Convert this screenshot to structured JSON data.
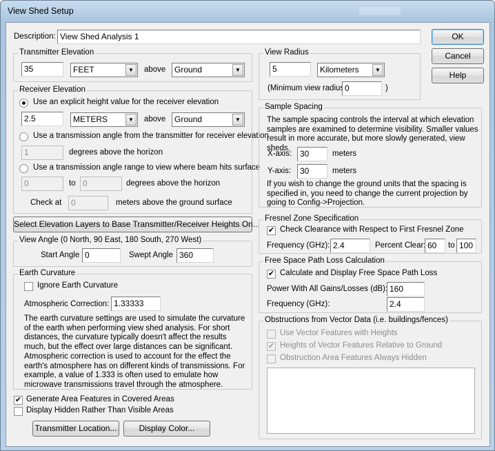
{
  "window": {
    "title": "View Shed Setup"
  },
  "description": {
    "label": "Description:",
    "value": "View Shed Analysis 1"
  },
  "buttons": {
    "ok": "OK",
    "cancel": "Cancel",
    "help": "Help"
  },
  "transmitter": {
    "legend": "Transmitter Elevation",
    "height": "35",
    "units": "FEET",
    "above_label": "above",
    "reference": "Ground"
  },
  "receiver": {
    "legend": "Receiver Elevation",
    "opt1_label": "Use an explicit height value for the receiver elevation",
    "height": "2.5",
    "units": "METERS",
    "above_label": "above",
    "reference": "Ground",
    "opt2_label": "Use a transmission angle from the transmitter for receiver elevation",
    "angle": "1",
    "angle_label": "degrees above the horizon",
    "opt3_label": "Use a transmission angle range to view where beam hits surface",
    "range_from": "0",
    "to_label": "to",
    "range_to": "0",
    "range_label": "degrees above the horizon",
    "check_at_label": "Check at",
    "check_at": "0",
    "check_at_suffix": "meters above the ground surface"
  },
  "elevation_layers_button": "Select Elevation Layers to Base Transmitter/Receiver Heights On...",
  "view_angle": {
    "legend": "View Angle (0 North, 90 East, 180 South, 270 West)",
    "start_label": "Start Angle",
    "start": "0",
    "swept_label": "Swept Angle",
    "swept": "360"
  },
  "curvature": {
    "legend": "Earth Curvature",
    "ignore_label": "Ignore Earth Curvature",
    "atmos_label": "Atmospheric Correction:",
    "atmos": "1.33333",
    "para1": "The earth curvature settings are used to simulate the curvature of the earth when performing view shed analysis. For short distances, the curvature typically doesn't affect the results much, but the effect over large distances can be significant.",
    "para2": "Atmospheric correction is used to account for the effect the earth's atmosphere has on different kinds of transmissions. For example, a value of 1.333 is often used to emulate how microwave transmissions travel through the atmosphere."
  },
  "options": {
    "generate_area": "Generate Area Features in Covered Areas",
    "display_hidden": "Display Hidden Rather Than Visible Areas"
  },
  "bottom_buttons": {
    "transmitter_location": "Transmitter Location...",
    "display_color": "Display Color..."
  },
  "view_radius": {
    "legend": "View Radius",
    "value": "5",
    "units": "Kilometers",
    "min_label": "(Minimum view radius:",
    "min": "0",
    "min_close": ")"
  },
  "sample_spacing": {
    "legend": "Sample Spacing",
    "para1": "The sample spacing controls the interval at which elevation samples are examined to determine visibility. Smaller values result in more accurate, but more slowly generated, view sheds.",
    "x_label": "X-axis:",
    "x": "30",
    "x_units": "meters",
    "y_label": "Y-axis:",
    "y": "30",
    "y_units": "meters",
    "para2": "If you wish to change the ground units that the spacing is specified in, you need to change the current projection by going to Config->Projection."
  },
  "fresnel": {
    "legend": "Fresnel Zone Specification",
    "check_label": "Check Clearance with Respect to First Fresnel Zone",
    "freq_label": "Frequency (GHz):",
    "freq": "2.4",
    "pct_label": "Percent Clear:",
    "pct_from": "60",
    "to_label": "to",
    "pct_to": "100"
  },
  "fspl": {
    "legend": "Free Space Path Loss Calculation",
    "check_label": "Calculate and Display Free Space Path Loss",
    "power_label": "Power With All Gains/Losses (dB):",
    "power": "160",
    "freq_label": "Frequency (GHz):",
    "freq": "2.4"
  },
  "obstructions": {
    "legend": "Obstructions from Vector Data (i.e. buildings/fences)",
    "opt1": "Use Vector Features with Heights",
    "opt2": "Heights of Vector Features Relative to Ground",
    "opt3": "Obstruction Area Features Always Hidden"
  }
}
